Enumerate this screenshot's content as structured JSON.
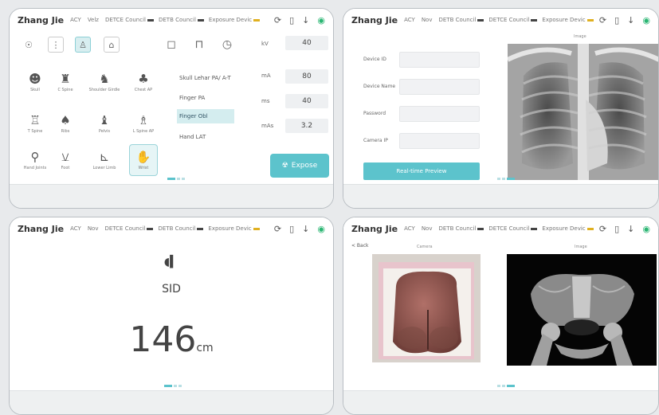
{
  "status_bars": [
    {
      "user": "Zhang Jie",
      "kv_label": "ACY",
      "kv_value": "Velz",
      "statuses": [
        "DETCE Council",
        "DETB Council",
        "Exposure Devic"
      ]
    },
    {
      "user": "Zhang Jie",
      "kv_label": "ACY",
      "kv_value": "Nov",
      "statuses": [
        "DETB Council",
        "DETCE Council",
        "Exposure Devic"
      ]
    },
    {
      "user": "Zhang Jie",
      "kv_label": "ACY",
      "kv_value": "Nov",
      "statuses": [
        "DETCE Council",
        "DETB Council",
        "Exposure Devic"
      ]
    },
    {
      "user": "Zhang Jie",
      "kv_label": "ACY",
      "kv_value": "Nov",
      "statuses": [
        "DETB Council",
        "DETCE Council",
        "Exposure Devic"
      ]
    }
  ],
  "panel1": {
    "body_parts": [
      {
        "icon": "☻",
        "label": "Skull"
      },
      {
        "icon": "♜",
        "label": "C Spine"
      },
      {
        "icon": "♞",
        "label": "Shoulder Girdle"
      },
      {
        "icon": "♣",
        "label": "Chest AP"
      },
      {
        "icon": "♖",
        "label": "T Spine"
      },
      {
        "icon": "♠",
        "label": "Ribs"
      },
      {
        "icon": "♝",
        "label": "Pelvis"
      },
      {
        "icon": "♗",
        "label": "L Spine AP"
      },
      {
        "icon": "⚲",
        "label": "Hand Joints"
      },
      {
        "icon": "⚺",
        "label": "Foot"
      },
      {
        "icon": "⊾",
        "label": "Lower Limb"
      },
      {
        "icon": "✋",
        "label": "Wrist"
      }
    ],
    "views": [
      "Skull Lehar PA/ A-T",
      "Finger PA",
      "Finger Obl",
      "Hand LAT"
    ],
    "params": [
      {
        "label": "kV",
        "value": "40"
      },
      {
        "label": "mA",
        "value": "80"
      },
      {
        "label": "ms",
        "value": "40"
      },
      {
        "label": "mAs",
        "value": "3.2"
      }
    ],
    "expose_label": "Expose"
  },
  "panel2": {
    "fields": [
      "Device ID",
      "Device Name",
      "Password",
      "Camera IP"
    ],
    "button": "Real-time Preview",
    "image_title": "Image"
  },
  "panel3": {
    "label": "SID",
    "value": "146",
    "unit": "cm"
  },
  "panel4": {
    "back": "< Back",
    "camera_title": "Camera",
    "image_title": "Image"
  },
  "colors": {
    "accent": "#5cc3cc",
    "wifi": "#2bb673"
  }
}
